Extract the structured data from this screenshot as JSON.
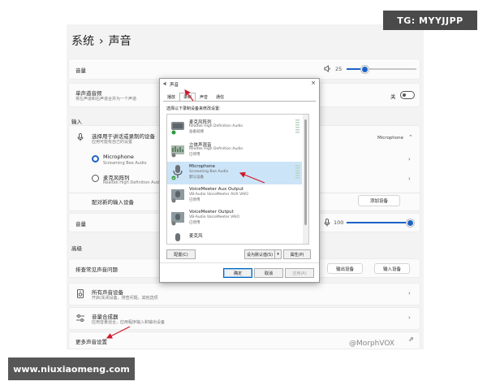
{
  "watermarks": {
    "top": "TG: MYYJJPP",
    "bottom": "www.niuxiaomeng.com",
    "morph": "@MorphVOX"
  },
  "breadcrumb": {
    "parent": "系统",
    "separator": "›",
    "current": "声音"
  },
  "volume_card": {
    "label": "音量",
    "value": "25",
    "level_percent": 25
  },
  "mono_card": {
    "title": "单声道音频",
    "subtitle": "将左声道和右声道合并为一个声道",
    "toggle_label": "关",
    "toggle_on": false
  },
  "input_section": {
    "label": "输入"
  },
  "choose_input": {
    "title": "选择用于讲话或录制的设备",
    "subtitle": "应用可能有自己的设置",
    "selected_value": "Microphone"
  },
  "inputs": [
    {
      "name": "Microphone",
      "sub": "Screaming Bee Audio",
      "selected": true
    },
    {
      "name": "麦克风阵列",
      "sub": "Realtek High Definition Audio",
      "selected": false
    }
  ],
  "pair_input": {
    "label": "配对新的输入设备",
    "button": "添加设备"
  },
  "input_volume": {
    "label": "音量",
    "value": "100",
    "level_percent": 100
  },
  "advanced_section": {
    "label": "高级"
  },
  "troubleshoot": {
    "label": "排查常见声音问题",
    "output_button": "输出设备",
    "input_button": "输入设备"
  },
  "all_devices": {
    "title": "所有声音设备",
    "subtitle": "开启/关闭设备，排查问题，其他选项"
  },
  "mixer": {
    "title": "音量合成器",
    "subtitle": "应用音量混合，应用程序输入和输出设备"
  },
  "more_settings": {
    "label": "更多声音设置"
  },
  "dialog": {
    "title": "声音",
    "close": "×",
    "tabs": [
      "播放",
      "录制",
      "声音",
      "通信"
    ],
    "active_tab": 1,
    "instruction": "选择以下录制设备来修改设置:",
    "devices": [
      {
        "name": "麦克风阵列",
        "sub": "Realtek High Definition Audio",
        "status": "准备就绪",
        "icon": "mic-array-icon",
        "selected": false
      },
      {
        "name": "立体声混音",
        "sub": "Realtek High Definition Audio",
        "status": "已停用",
        "icon": "stereo-mix-icon",
        "selected": false
      },
      {
        "name": "Microphone",
        "sub": "Screaming Bee Audio",
        "status": "默认设备",
        "icon": "microphone-icon",
        "selected": true
      },
      {
        "name": "VoiceMeeter Aux Output",
        "sub": "VB-Audio VoiceMeeter AUX VAIO",
        "status": "已停用",
        "icon": "voicemeeter-aux-icon",
        "selected": false
      },
      {
        "name": "VoiceMeeter Output",
        "sub": "VB-Audio VoiceMeeter VAIO",
        "status": "已停用",
        "icon": "voicemeeter-icon",
        "selected": false
      },
      {
        "name": "麦克风",
        "sub": "",
        "status": "",
        "icon": "microphone-icon",
        "selected": false
      }
    ],
    "configure": "配置(C)",
    "set_default": "设为默认值(S)",
    "properties": "属性(P)",
    "ok": "确定",
    "cancel": "取消",
    "apply": "应用(A)"
  },
  "colors": {
    "accent": "#1e62c8",
    "annotation": "#d0182a",
    "selection": "#cce4f7"
  }
}
